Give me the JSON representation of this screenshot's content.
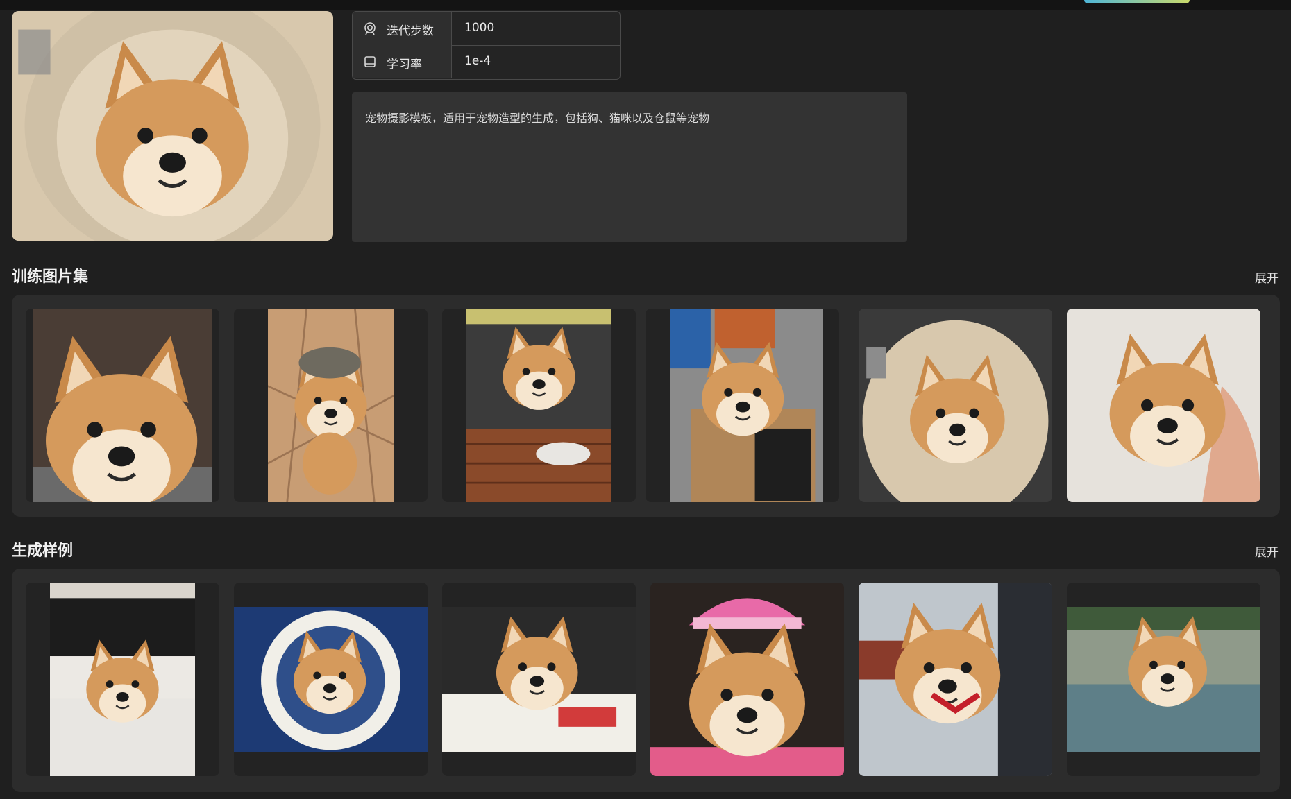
{
  "params": [
    {
      "icon": "target-icon",
      "label": "迭代步数",
      "value": "1000"
    },
    {
      "icon": "book-icon",
      "label": "学习率",
      "value": "1e-4"
    }
  ],
  "description": "宠物摄影模板，适用于宠物造型的生成，包括狗、猫咪以及仓鼠等宠物",
  "training_section": {
    "title": "训练图片集",
    "expand_label": "展开"
  },
  "samples_section": {
    "title": "生成样例",
    "expand_label": "展开"
  },
  "colors": {
    "background": "#1f1f1f",
    "panel": "#2c2c2c",
    "accent_gradient": [
      "#4fb6d8",
      "#c9d96a"
    ]
  }
}
